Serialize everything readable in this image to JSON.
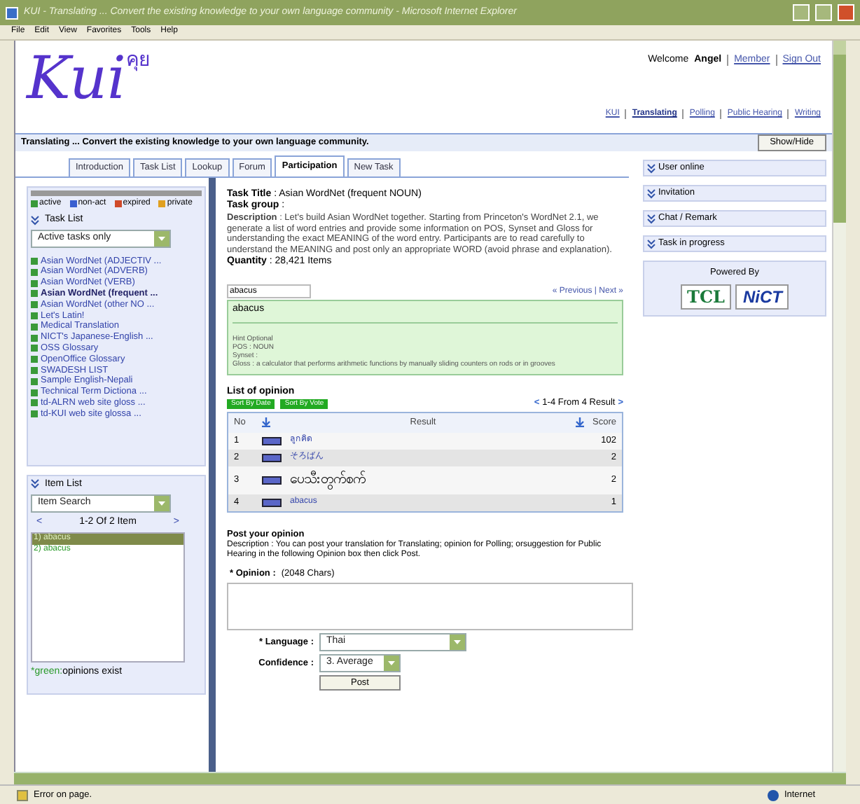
{
  "window": {
    "title": "KUI - Translating ... Convert the existing knowledge to your own language community - Microsoft Internet Explorer"
  },
  "menu": [
    "File",
    "Edit",
    "View",
    "Favorites",
    "Tools",
    "Help"
  ],
  "header": {
    "logo": "Kui",
    "logo_thai": "คุย",
    "welcome": "Welcome",
    "user": "Angel",
    "user_links": [
      "Member",
      "Sign Out"
    ],
    "nav": [
      {
        "label": "KUI",
        "selected": false
      },
      {
        "label": "Translating",
        "selected": true
      },
      {
        "label": "Polling",
        "selected": false
      },
      {
        "label": "Public Hearing",
        "selected": false
      },
      {
        "label": "Writing",
        "selected": false
      }
    ]
  },
  "banner": {
    "text": "Translating ... Convert the existing knowledge to your own language community.",
    "button": "Show/Hide"
  },
  "tabs": [
    {
      "label": "Introduction",
      "selected": false
    },
    {
      "label": "Task List",
      "selected": false
    },
    {
      "label": "Lookup",
      "selected": false
    },
    {
      "label": "Forum",
      "selected": false
    },
    {
      "label": "Participation",
      "selected": true
    },
    {
      "label": "New Task",
      "selected": false
    }
  ],
  "legend": [
    {
      "label": "active",
      "color": "#3a9a3a"
    },
    {
      "label": "non-act",
      "color": "#3a5fd0"
    },
    {
      "label": "expired",
      "color": "#d04a2a"
    },
    {
      "label": "private",
      "color": "#e0a020"
    }
  ],
  "task_list": {
    "title": "Task List",
    "filter": "Active tasks only",
    "items": [
      {
        "label": "Asian WordNet (ADJECTIV ...",
        "selected": false
      },
      {
        "label": "Asian WordNet (ADVERB)",
        "selected": false
      },
      {
        "label": "Asian WordNet (VERB)",
        "selected": false
      },
      {
        "label": "Asian WordNet (frequent ...",
        "selected": true
      },
      {
        "label": "Asian WordNet (other NO ...",
        "selected": false
      },
      {
        "label": "Let's Latin!",
        "selected": false
      },
      {
        "label": "Medical Translation",
        "selected": false
      },
      {
        "label": "NICT's Japanese-English ...",
        "selected": false
      },
      {
        "label": "OSS Glossary",
        "selected": false
      },
      {
        "label": "OpenOffice Glossary",
        "selected": false
      },
      {
        "label": "SWADESH LIST",
        "selected": false
      },
      {
        "label": "Sample English-Nepali",
        "selected": false
      },
      {
        "label": "Technical Term Dictiona ...",
        "selected": false
      },
      {
        "label": "td-ALRN web site gloss ...",
        "selected": false
      },
      {
        "label": "td-KUI web site glossa ...",
        "selected": false
      }
    ]
  },
  "item_list": {
    "title": "Item List",
    "search": "Item Search",
    "pager": "1-2 Of 2 Item",
    "prev": "<",
    "next": ">",
    "items": [
      {
        "label": "1) abacus",
        "selected": true
      },
      {
        "label": "2) abacus",
        "selected": false
      }
    ],
    "note": {
      "mark": "*",
      "highlight": "green:",
      "text": "opinions exist"
    }
  },
  "task": {
    "lines": [
      "**Task Title** : Asian WordNet (frequent NOUN)",
      "**Task group** :"
    ],
    "description": "**Description** : Let's build Asian WordNet together. Starting from Princeton's WordNet 2.1, we generate a list of word entries and provide some information on POS, Synset and Gloss for understanding the exact MEANING of the word entry. Participants are to read carefully to understand the MEANING and post only an appropriate WORD (avoid phrase and explanation).",
    "quantity": "**Quantity** : 28,421 Items"
  },
  "entry": {
    "value": "abacus",
    "pager": "« Previous | Next »",
    "word": "abacus",
    "info": [
      "Hint Optional",
      "POS : NOUN",
      "Synset :",
      "Gloss : a calculator that performs arithmetic functions by manually sliding counters on rods or in grooves"
    ]
  },
  "opinions": {
    "title": "List of opinion",
    "sort_buttons": [
      "Sort By Date",
      "Sort By Vote"
    ],
    "pager": "1-4 From 4 Result",
    "prev": "<",
    "next": ">",
    "columns": [
      "No",
      "Result",
      "Score"
    ],
    "rows": [
      {
        "no": "1",
        "result": "ลูกคิด",
        "score": "102",
        "large": false
      },
      {
        "no": "2",
        "result": "そろばん",
        "score": "2",
        "large": false
      },
      {
        "no": "3",
        "result": "ပေသီးတွက်စက်",
        "score": "2",
        "large": true
      },
      {
        "no": "4",
        "result": "abacus",
        "score": "1",
        "large": false
      }
    ]
  },
  "post": {
    "title": "Post your opinion",
    "description": "Description : You can post your translation for Translating; opinion for Polling; orsuggestion for Public Hearing in the following Opinion box then click Post.",
    "opinion_label": "* Opinion :",
    "opinion_hint": "(2048 Chars)",
    "language_label": "* Language :",
    "language": "Thai",
    "confidence_label": "Confidence :",
    "confidence": "3. Average",
    "button": "Post"
  },
  "side_panels": [
    {
      "label": "User online"
    },
    {
      "label": "Invitation"
    },
    {
      "label": "Chat / Remark"
    },
    {
      "label": "Task in progress"
    }
  ],
  "powered": {
    "title": "Powered By",
    "logos": [
      "TCL",
      "NiCT"
    ]
  },
  "status_bar": {
    "text": "Error on page.",
    "zone": "Internet"
  }
}
